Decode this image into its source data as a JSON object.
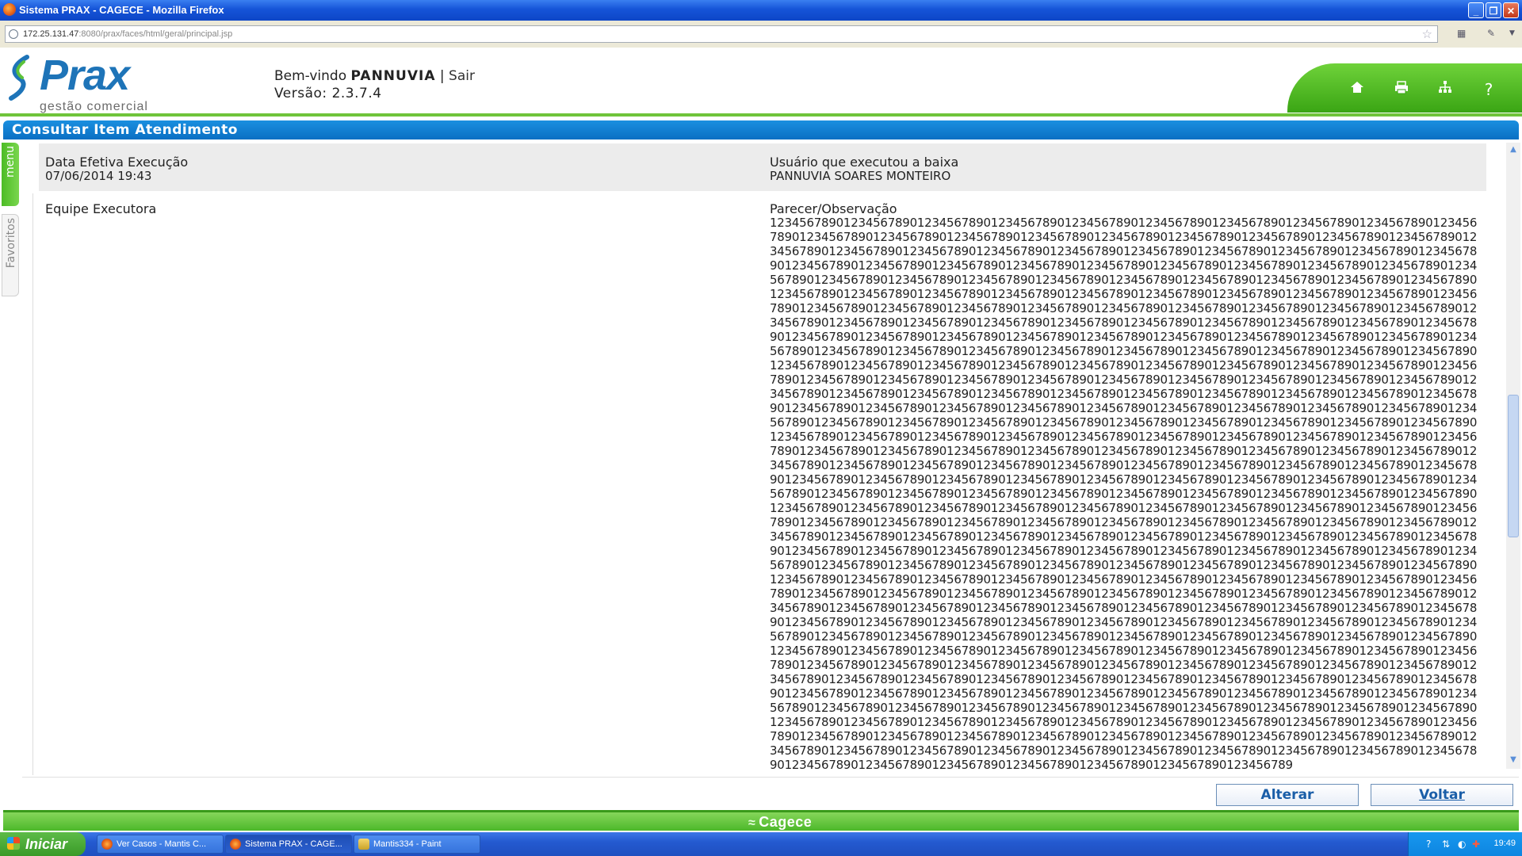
{
  "window": {
    "title": "Sistema PRAX - CAGECE - Mozilla Firefox",
    "min": "_",
    "max": "❐",
    "close": "✕"
  },
  "browser": {
    "url_host": "172.25.131.47",
    "url_rest": ":8080/prax/faces/html/geral/principal.jsp",
    "bookmark_icon": "☆"
  },
  "header": {
    "logo_main": "Prax",
    "logo_sub": "gestão comercial",
    "welcome_prefix": "Bem-vindo ",
    "username": "PANNUVIA",
    "separator": " | ",
    "logout": "Sair",
    "version": "Versão: 2.3.7.4",
    "icons": [
      "home-icon",
      "print-icon",
      "sitemap-icon",
      "help-icon"
    ],
    "help_glyph": "?"
  },
  "section": {
    "title": "Consultar Item Atendimento"
  },
  "side_tabs": {
    "menu": "menu",
    "favorites": "Favoritos"
  },
  "details": {
    "data_execucao_label": "Data Efetiva Execução",
    "data_execucao_value": "07/06/2014 19:43",
    "usuario_label": "Usuário que executou a baixa",
    "usuario_value": "PANNUVIA SOARES MONTEIRO",
    "equipe_label": "Equipe Executora",
    "parecer_label": "Parecer/Observação",
    "parecer_value": "12345678901234567890123456789012345678901234567890123456789012345678901234567890123456789012345678901234567890123456789012345678901234567890123456789012345678901234567890123456789012345678901234567890123456789012345678901234567890123456789012345678901234567890123456789012345678901234567890123456789012345678901234567890123456789012345678901234567890123456789012345678901234567890123456789012345678901234567890123456789012345678901234567890123456789012345678901234567890123456789012345678901234567890123456789012345678901234567890123456789012345678901234567890123456789012345678901234567890123456789012345678901234567890123456789012345678901234567890123456789012345678901234567890123456789012345678901234567890123456789012345678901234567890123456789012345678901234567890123456789012345678901234567890123456789012345678901234567890123456789012345678901234567890123456789012345678901234567890123456789012345678901234567890123456789012345678901234567890123456789012345678901234567890123456789012345678901234567890123456789012345678901234567890123456789012345678901234567890123456789012345678901234567890123456789012345678901234567890123456789012345678901234567890123456789012345678901234567890123456789012345678901234567890123456789012345678901234567890123456789012345678901234567890123456789012345678901234567890123456789012345678901234567890123456789012345678901234567890123456789012345678901234567890123456789012345678901234567890123456789012345678901234567890123456789012345678901234567890123456789012345678901234567890123456789012345678901234567890123456789012345678901234567890123456789012345678901234567890123456789012345678901234567890123456789012345678901234567890123456789012345678901234567890123456789012345678901234567890123456789012345678901234567890123456789012345678901234567890123456789012345678901234567890123456789012345678901234567890123456789012345678901234567890123456789012345678901234567890123456789012345678901234567890123456789012345678901234567890123456789012345678901234567890123456789012345678901234567890123456789012345678901234567890123456789012345678901234567890123456789012345678901234567890123456789012345678901234567890123456789012345678901234567890123456789012345678901234567890123456789012345678901234567890123456789012345678901234567890123456789012345678901234567890123456789012345678901234567890123456789012345678901234567890123456789012345678901234567890123456789012345678901234567890123456789012345678901234567890123456789012345678901234567890123456789012345678901234567890123456789012345678901234567890123456789012345678901234567890123456789012345678901234567890123456789012345678901234567890123456789012345678901234567890123456789012345678901234567890123456789012345678901234567890123456789012345678901234567890123456789012345678901234567890123456789012345678901234567890123456789012345678901234567890123456789012345678901234567890123456789012345678901234567890123456789012345678901234567890123456789012345678901234567890123456789012345678901234567890123456789012345678901234567890123456789012345678901234567890123456789012345678901234567890123456789012345678901234567890123456789012345678901234567890123456789012345678901234567890123456789012345678901234567890123456789012345678901234567890123456789012345678901234567890123456789012345678901234567890123456789012345678901234567890123456789012345678901234567890123456789012345678901234567890123456789012345678901234567890123456789012345678901234567890123456789012345678901234567890123456789012345678901234567890123456789012345678901234567890123456789012345678901234567890123456789012345678901234567890123456789012345678901234567890123456789012345678901234567890123456789012345678901234567890123456789012345678901234567890123456789"
  },
  "actions": {
    "alterar": "Alterar",
    "voltar": "Voltar"
  },
  "footer": {
    "brand": "Cagece"
  },
  "taskbar": {
    "start": "Iniciar",
    "tasks": [
      {
        "label": "Ver Casos - Mantis C..."
      },
      {
        "label": "Sistema PRAX - CAGE..."
      },
      {
        "label": "Mantis334 - Paint"
      }
    ],
    "clock": "19:49"
  },
  "colors": {
    "accent_blue": "#0a6fc3",
    "accent_green": "#4cb82a",
    "logo_blue": "#1e74b8"
  }
}
